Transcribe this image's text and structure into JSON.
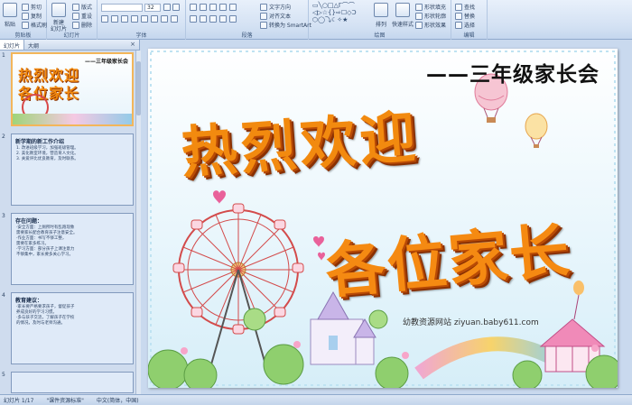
{
  "ribbon": {
    "clipboard": {
      "label": "剪贴板",
      "paste": "粘贴",
      "cut": "剪切",
      "copy": "复制",
      "format_painter": "格式刷"
    },
    "slides": {
      "label": "幻灯片",
      "new_slide": "新建\n幻灯片",
      "layout": "版式",
      "reset": "重设",
      "delete": "删除"
    },
    "font": {
      "label": "字体",
      "font_size": "32"
    },
    "paragraph": {
      "label": "段落",
      "text_direction": "文字方向",
      "align_text": "对齐文本",
      "smartart": "转换为 SmartArt"
    },
    "drawing": {
      "label": "绘图",
      "arrange": "排列",
      "quick_styles": "快速样式",
      "shape_fill": "形状填充",
      "shape_outline": "形状轮廓",
      "shape_effects": "形状效果"
    },
    "editing": {
      "label": "编辑",
      "find": "查找",
      "replace": "替换",
      "select": "选择"
    }
  },
  "left_pane": {
    "tabs": [
      "幻灯片",
      "大纲"
    ],
    "close": "×",
    "thumbnails": [
      {
        "number": "1",
        "title": "——三年级家长会",
        "lines": "热烈欢迎\n各位家长"
      },
      {
        "number": "2",
        "title": "新学期的新工作介绍",
        "lines": "1. 改进班级学习，加强班级管理。\n2. 美化教室环境，营造育人文化。\n3. 关爱评比优良教育，及时联系。"
      },
      {
        "number": "3",
        "title": "存在问题：",
        "lines": "·安全方面：上厕所时有乱跑现象\n  需要家长配合教育孩子注意安全。\n·作业方面：书写不够工整，\n  需要在家多练习。\n·学习方面：部分孩子上课注意力\n  不够集中，家长要多关心学习。"
      },
      {
        "number": "4",
        "title": "教育建议：",
        "lines": "·家长要严格要求孩子，督促孩子\n  养成良好的学习习惯。\n·多与孩子交流，了解孩子在学校\n  的情况，及时与老师沟通。"
      },
      {
        "number": "5",
        "title": "",
        "lines": ""
      }
    ]
  },
  "slide": {
    "subtitle": "——三年级家长会",
    "title_line1": "热烈欢迎",
    "title_line2": "各位家长",
    "watermark": "幼教资源网站  ziyuan.baby611.com"
  },
  "statusbar": {
    "slide_index": "幻灯片 1/17",
    "theme": "\"课件资源标准\"",
    "language": "中文(简体，中国)"
  }
}
